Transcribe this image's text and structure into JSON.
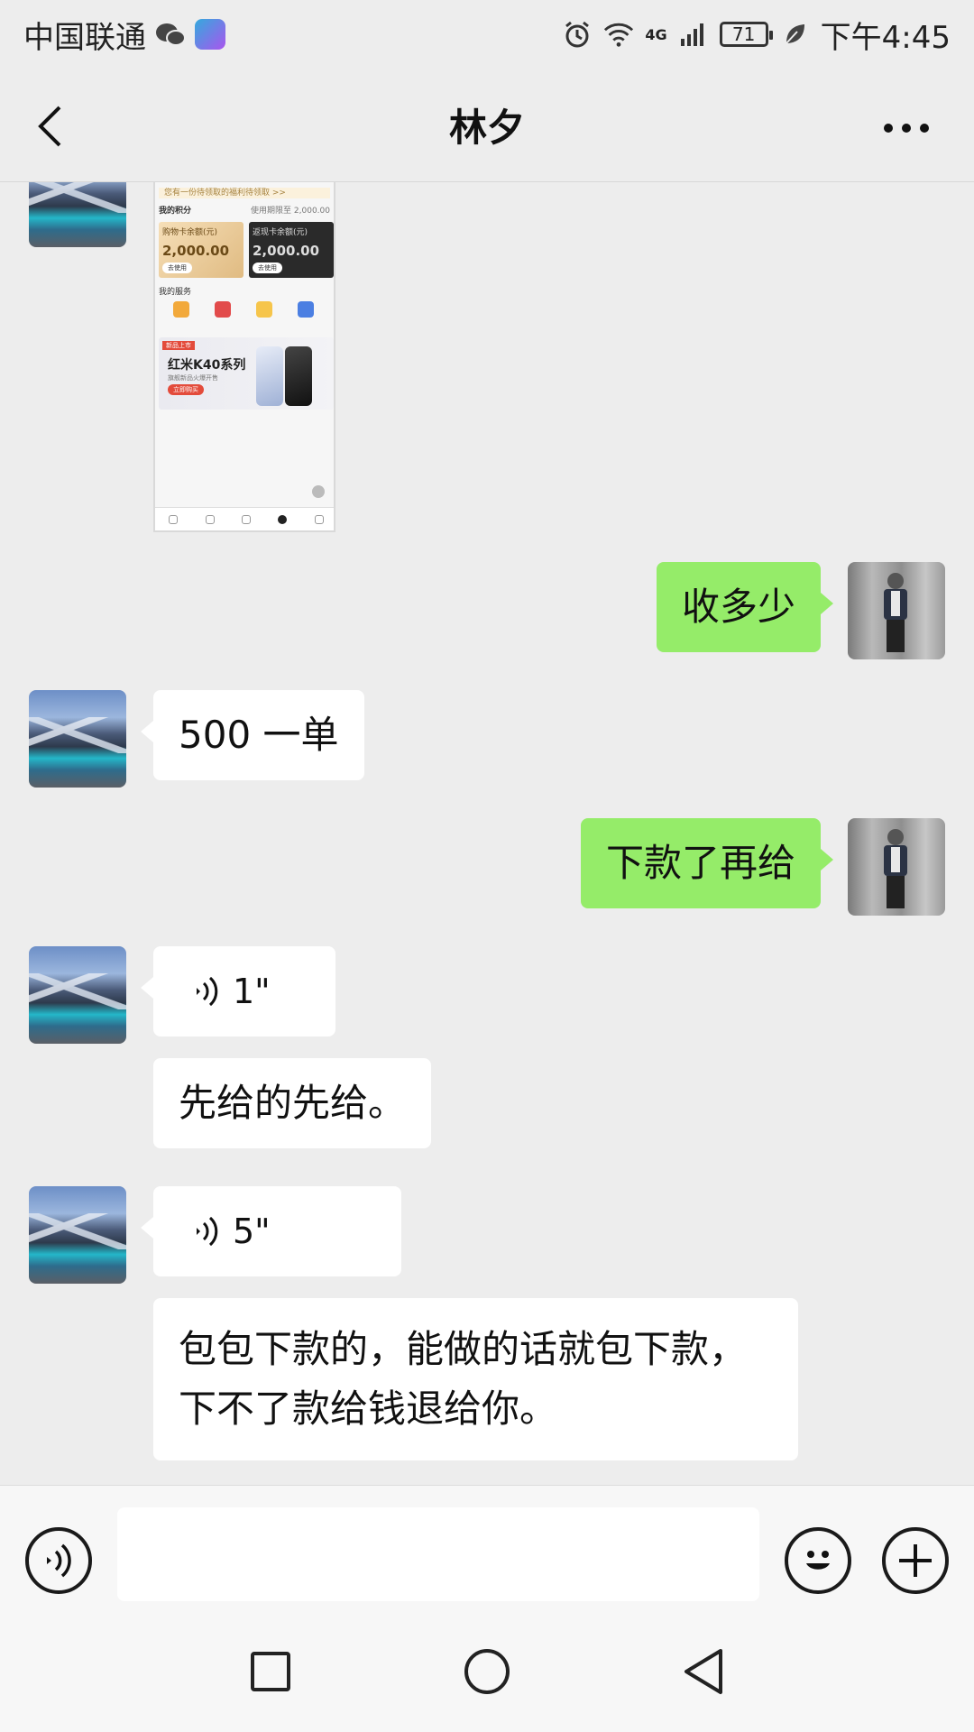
{
  "status_bar": {
    "carrier": "中国联通",
    "network": "4G",
    "battery": "71",
    "time": "下午4:45"
  },
  "header": {
    "title": "林夕",
    "back_icon": "chevron-left-icon",
    "more_icon": "more-horizontal-icon"
  },
  "thumbnail": {
    "notice": "您有一份待领取的福利待领取 >>",
    "section": "我的积分",
    "meta": "使用期限至 2,000.00",
    "card1_title": "购物卡余额(元)",
    "card1_amount": "2,000.00",
    "card1_button": "去使用",
    "card2_title": "返现卡余额(元)",
    "card2_amount": "2,000.00",
    "card2_button": "去使用",
    "services": "我的服务",
    "banner_tag": "新品上市",
    "banner_title": "红米K40系列",
    "banner_sub": "旗舰新品火爆开售",
    "banner_btn": "立即购买"
  },
  "messages": [
    {
      "side": "right",
      "text": "收多少"
    },
    {
      "side": "left",
      "text": "500 一单"
    },
    {
      "side": "right",
      "text": "下款了再给"
    },
    {
      "side": "left",
      "type": "voice",
      "duration": "1\""
    },
    {
      "side": "left",
      "text": "先给的先给。"
    },
    {
      "side": "left",
      "type": "voice",
      "duration": "5\""
    },
    {
      "side": "left",
      "text_line1": "包包下款的，能做的话就包下款，",
      "text_line2": "下不了款给钱退给你。"
    }
  ],
  "input_bar": {
    "voice_icon": "voice-icon",
    "emoji_icon": "emoji-icon",
    "plus_icon": "plus-icon",
    "placeholder": ""
  },
  "nav_bar": {
    "recent_icon": "square-icon",
    "home_icon": "circle-icon",
    "back_icon": "triangle-back-icon"
  },
  "colors": {
    "background": "#ededed",
    "sent_bubble": "#95ec69",
    "received_bubble": "#ffffff"
  }
}
